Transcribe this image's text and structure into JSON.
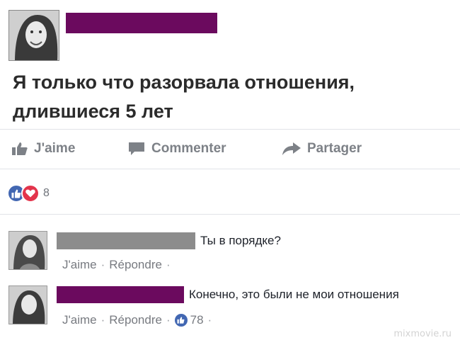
{
  "post": {
    "text_line1": "Я только что разорвала отношения,",
    "text_line2": "длившиеся 5 лет"
  },
  "actions": {
    "like": "J'aime",
    "comment": "Commenter",
    "share": "Partager"
  },
  "reactions": {
    "count": "8"
  },
  "comments": [
    {
      "text": "Ты в порядке?",
      "like": "J'aime",
      "reply": "Répondre",
      "redaction_color": "#8c8c8c"
    },
    {
      "text": "Конечно, это были не мои отношения",
      "like": "J'aime",
      "reply": "Répondre",
      "likes": "78",
      "redaction_color": "#6b0a5e"
    }
  ],
  "watermark": "mixmovie.ru",
  "colors": {
    "facebook_blue": "#4267b2",
    "love_red": "#e3344b",
    "redaction_purple": "#6b0a5e",
    "redaction_gray": "#8c8c8c"
  }
}
